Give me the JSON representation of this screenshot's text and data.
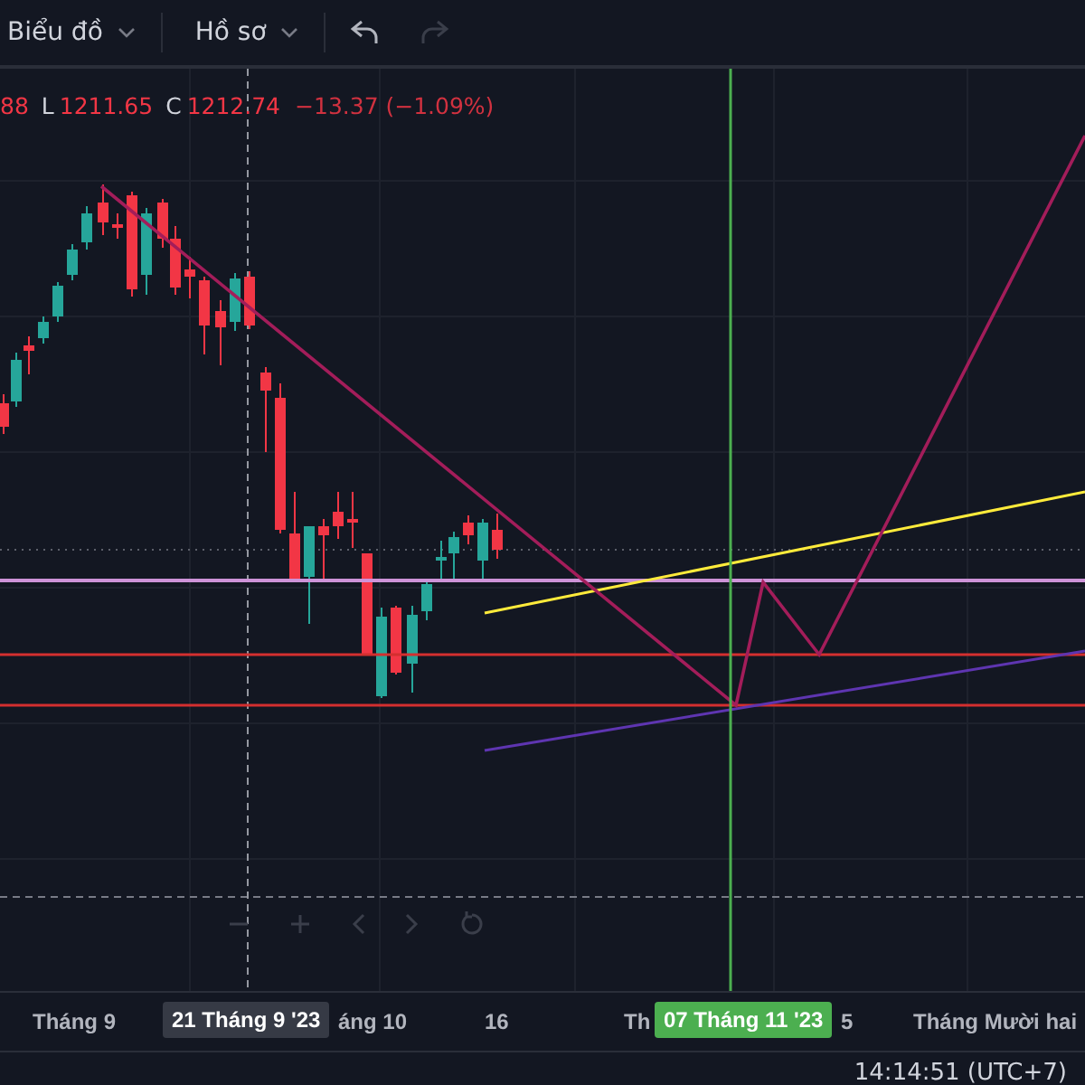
{
  "toolbar": {
    "menus": [
      {
        "label": "Biểu đồ"
      },
      {
        "label": "Hồ sơ"
      }
    ],
    "undo": {
      "disabled": false
    },
    "redo": {
      "disabled": true
    }
  },
  "legend": {
    "high_tail": "88",
    "low_key": "L",
    "low": "1211.65",
    "close_key": "C",
    "close": "1212.74",
    "change": "−13.37 (−1.09%)"
  },
  "time_axis": {
    "labels": [
      {
        "text": "Tháng 9"
      },
      {
        "text": "áng 10"
      },
      {
        "text": "16"
      },
      {
        "text": "Th"
      },
      {
        "text": "5"
      },
      {
        "text": "Tháng Mười hai"
      }
    ],
    "crosshair_label": "21 Tháng 9 '23",
    "cursor_label": "07 Tháng 11 '23"
  },
  "status_bar": {
    "time": "14:14:51 (UTC+7)"
  }
}
